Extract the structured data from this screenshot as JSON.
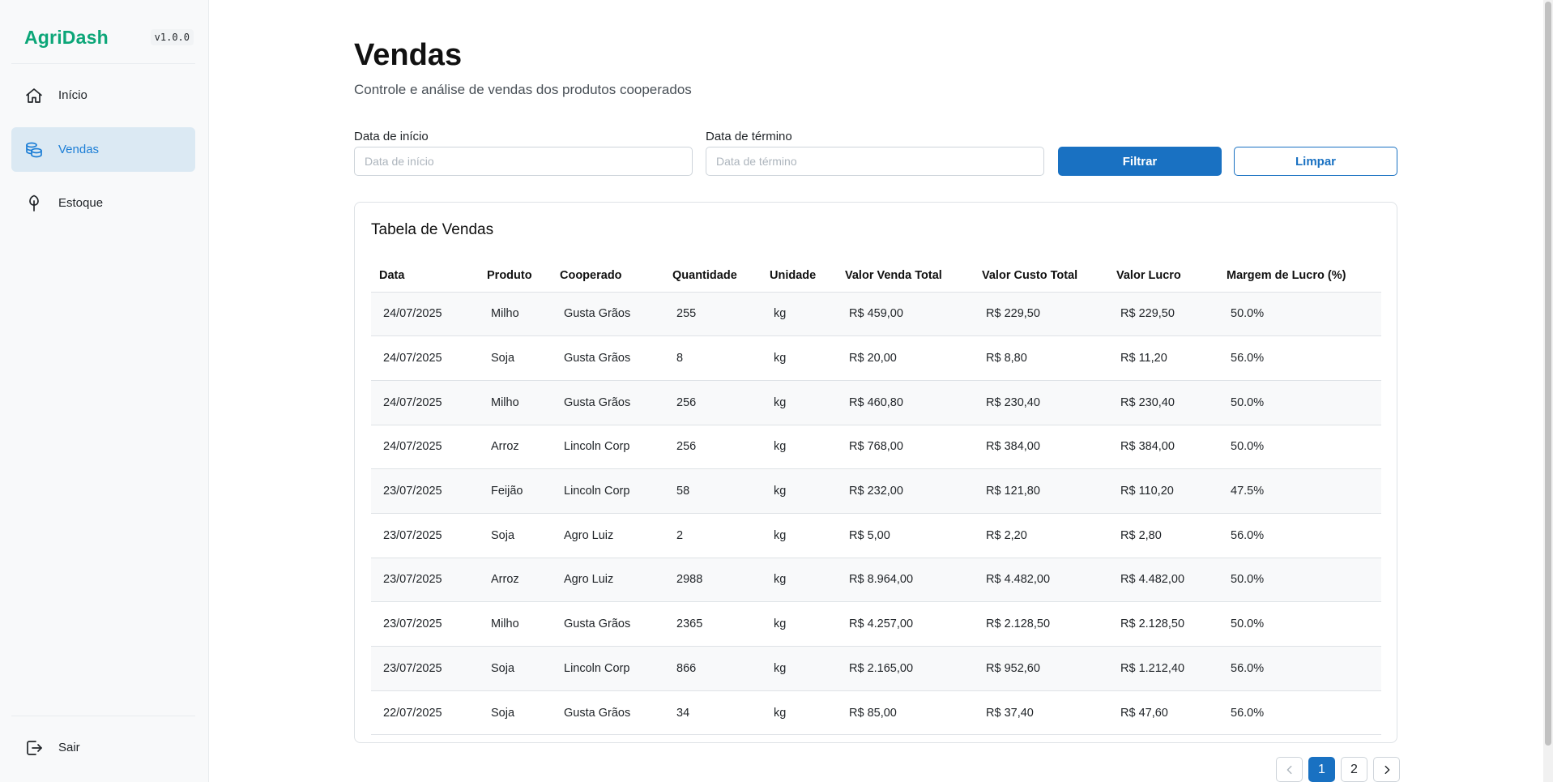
{
  "app": {
    "brand": "AgriDash",
    "version": "v1.0.0"
  },
  "sidebar": {
    "items": [
      {
        "label": "Início",
        "icon": "home-icon",
        "active": false
      },
      {
        "label": "Vendas",
        "icon": "coins-icon",
        "active": true
      },
      {
        "label": "Estoque",
        "icon": "plant-icon",
        "active": false
      }
    ],
    "logout": {
      "label": "Sair",
      "icon": "logout-icon"
    }
  },
  "page": {
    "title": "Vendas",
    "subtitle": "Controle e análise de vendas dos produtos cooperados"
  },
  "filters": {
    "start": {
      "label": "Data de início",
      "placeholder": "Data de início"
    },
    "end": {
      "label": "Data de término",
      "placeholder": "Data de término"
    },
    "filter_button": "Filtrar",
    "clear_button": "Limpar"
  },
  "table": {
    "title": "Tabela de Vendas",
    "columns": [
      "Data",
      "Produto",
      "Cooperado",
      "Quantidade",
      "Unidade",
      "Valor Venda Total",
      "Valor Custo Total",
      "Valor Lucro",
      "Margem de Lucro (%)"
    ],
    "rows": [
      [
        "24/07/2025",
        "Milho",
        "Gusta Grãos",
        "255",
        "kg",
        "R$ 459,00",
        "R$ 229,50",
        "R$ 229,50",
        "50.0%"
      ],
      [
        "24/07/2025",
        "Soja",
        "Gusta Grãos",
        "8",
        "kg",
        "R$ 20,00",
        "R$ 8,80",
        "R$ 11,20",
        "56.0%"
      ],
      [
        "24/07/2025",
        "Milho",
        "Gusta Grãos",
        "256",
        "kg",
        "R$ 460,80",
        "R$ 230,40",
        "R$ 230,40",
        "50.0%"
      ],
      [
        "24/07/2025",
        "Arroz",
        "Lincoln Corp",
        "256",
        "kg",
        "R$ 768,00",
        "R$ 384,00",
        "R$ 384,00",
        "50.0%"
      ],
      [
        "23/07/2025",
        "Feijão",
        "Lincoln Corp",
        "58",
        "kg",
        "R$ 232,00",
        "R$ 121,80",
        "R$ 110,20",
        "47.5%"
      ],
      [
        "23/07/2025",
        "Soja",
        "Agro Luiz",
        "2",
        "kg",
        "R$ 5,00",
        "R$ 2,20",
        "R$ 2,80",
        "56.0%"
      ],
      [
        "23/07/2025",
        "Arroz",
        "Agro Luiz",
        "2988",
        "kg",
        "R$ 8.964,00",
        "R$ 4.482,00",
        "R$ 4.482,00",
        "50.0%"
      ],
      [
        "23/07/2025",
        "Milho",
        "Gusta Grãos",
        "2365",
        "kg",
        "R$ 4.257,00",
        "R$ 2.128,50",
        "R$ 2.128,50",
        "50.0%"
      ],
      [
        "23/07/2025",
        "Soja",
        "Lincoln Corp",
        "866",
        "kg",
        "R$ 2.165,00",
        "R$ 952,60",
        "R$ 1.212,40",
        "56.0%"
      ],
      [
        "22/07/2025",
        "Soja",
        "Gusta Grãos",
        "34",
        "kg",
        "R$ 85,00",
        "R$ 37,40",
        "R$ 47,60",
        "56.0%"
      ]
    ]
  },
  "pagination": {
    "pages": [
      "1",
      "2"
    ],
    "current": "1"
  },
  "colors": {
    "brand": "#0ca678",
    "primary": "#1971c2",
    "active_nav_bg": "#dbe9f3"
  }
}
